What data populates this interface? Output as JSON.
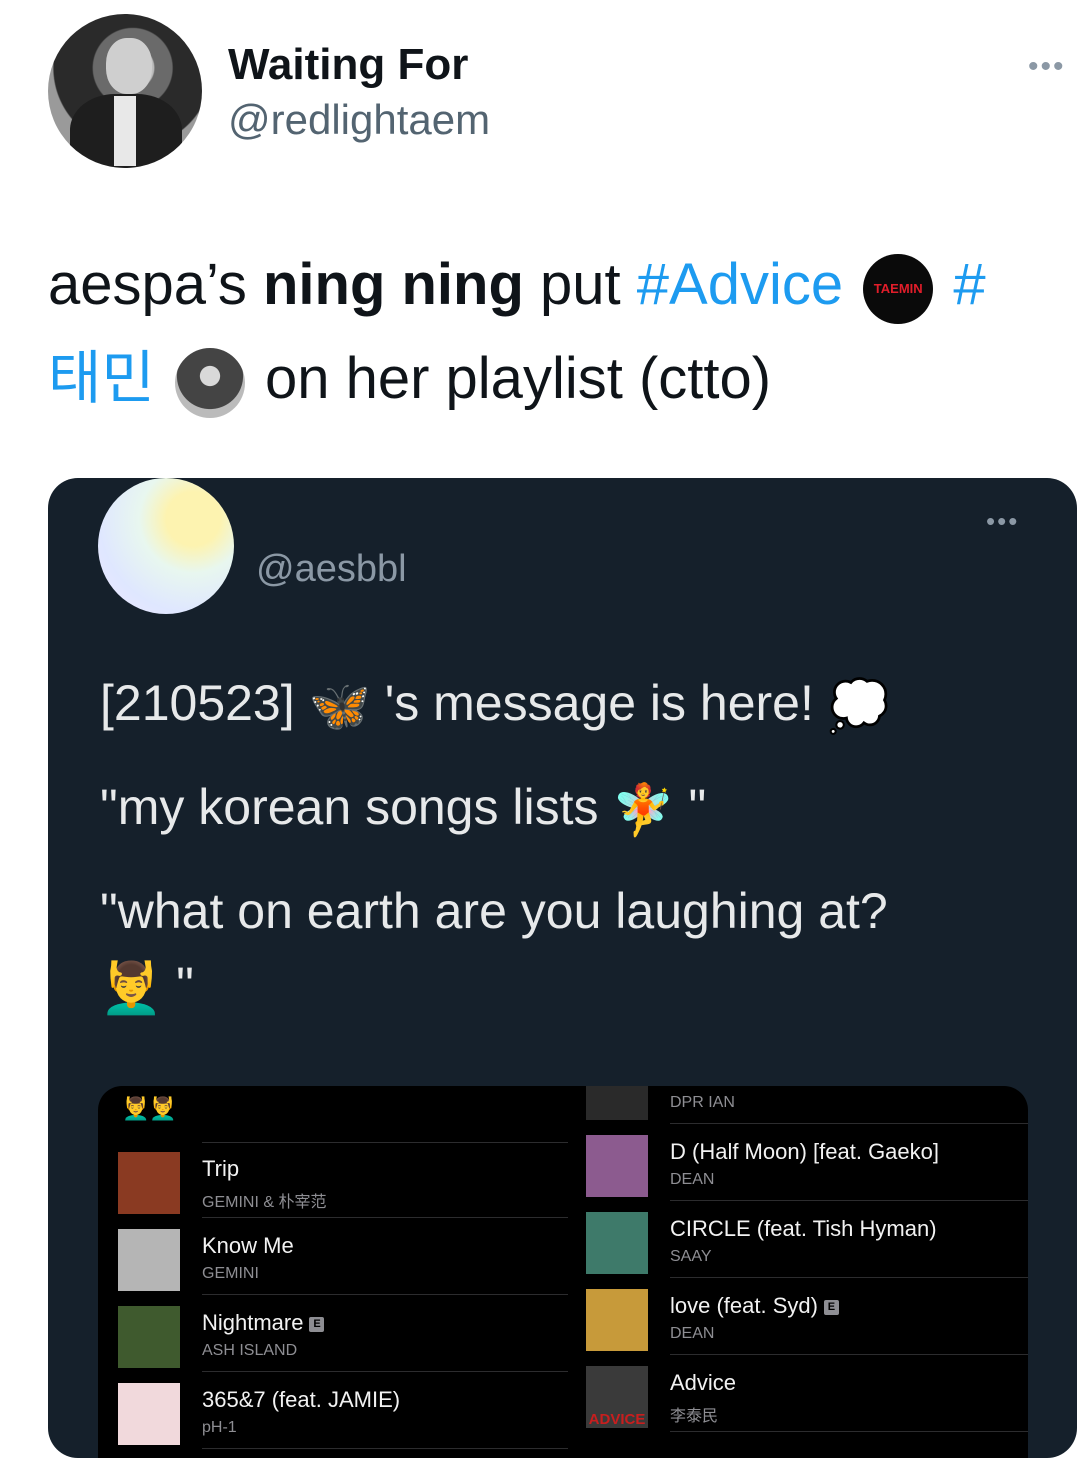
{
  "author": {
    "display_name": "Waiting For",
    "handle": "@redlightaem",
    "more_label": "•••"
  },
  "tweet": {
    "part1": "aespa’s ",
    "bold": "ning ning",
    "part2": " put ",
    "hashtag1": "#Advice",
    "hashflag1_text": "TAEMIN",
    "hashtag2_prefix": " #",
    "hashtag2_rest": "태민",
    "part3": " on her playlist (ctto)"
  },
  "quoted": {
    "handle": "@aesbbl",
    "more_label": "•••",
    "line1_pre": "[210523] ",
    "line1_post": " 's message is here! ",
    "line2_pre": "\"my korean songs lists ",
    "line2_post": " \"",
    "line3": "\"what on earth are you laughing at?",
    "line4_post": " \"",
    "emoji": {
      "butterfly": "🦋",
      "thought": "💭",
      "fairy": "🧚",
      "man": "💆‍♂️"
    }
  },
  "playlist": {
    "header_emoji": "💆‍♂️💆‍♂️",
    "explicit_label": "E",
    "left_tracks": [
      {
        "title": "Trip",
        "artist": "GEMINI & 朴宰范",
        "explicit": false,
        "color": "#8a3a22"
      },
      {
        "title": "Know Me",
        "artist": "GEMINI",
        "explicit": false,
        "color": "#b5b5b5"
      },
      {
        "title": "Nightmare",
        "artist": "ASH ISLAND",
        "explicit": true,
        "color": "#3f5a2e"
      },
      {
        "title": "365&7 (feat. JAMIE)",
        "artist": "pH-1",
        "explicit": false,
        "color": "#f1d9dc"
      }
    ],
    "right_tracks": [
      {
        "title": "",
        "artist": "DPR IAN",
        "explicit": false,
        "color": "#2a2a2a"
      },
      {
        "title": "D (Half Moon) [feat. Gaeko]",
        "artist": "DEAN",
        "explicit": false,
        "color": "#8c5b8f"
      },
      {
        "title": "CIRCLE (feat. Tish Hyman)",
        "artist": "SAAY",
        "explicit": false,
        "color": "#3e7a6a"
      },
      {
        "title": "love (feat. Syd)",
        "artist": "DEAN",
        "explicit": true,
        "color": "#c79a3a"
      },
      {
        "title": "Advice",
        "artist": "李泰民",
        "explicit": false,
        "color": "#3a3a3a",
        "thumb_text": "ADVICE"
      }
    ]
  }
}
